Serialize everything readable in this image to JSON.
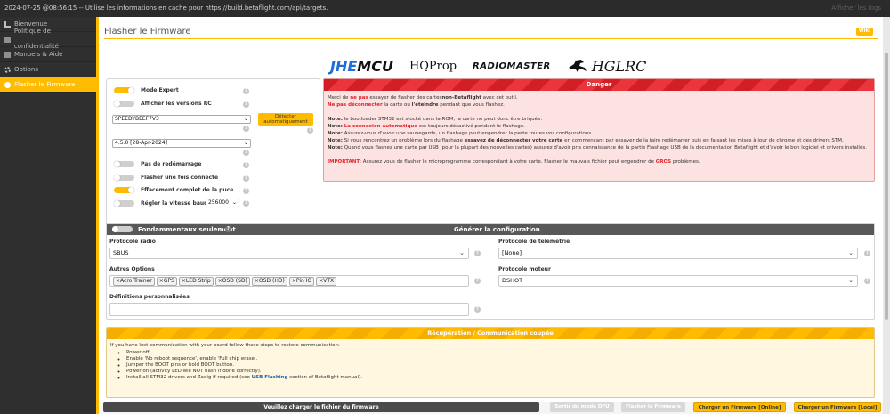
{
  "logbar": {
    "message": "2024-07-25 @08:56:15 -- Utilise les informations en cache pour https://build.betaflight.com/api/targets.",
    "show_log": "Afficher les logs"
  },
  "sidebar": {
    "items": [
      {
        "label": "Bienvenue",
        "icon": "home-icon"
      },
      {
        "label": "Politique de confidentialité",
        "icon": "document-icon"
      },
      {
        "label": "Manuels & Aide",
        "icon": "book-icon"
      },
      {
        "label": "Options",
        "icon": "gear-icon"
      },
      {
        "label": "Flasher le Firmware",
        "icon": "flash-icon",
        "active": true
      }
    ]
  },
  "header": {
    "title": "Flasher le Firmware",
    "wiki": "WIKI"
  },
  "logos": {
    "jhe": "JHE",
    "mcu": "MCU",
    "hqprop": "HQProp",
    "radiomaster": "RADIOMASTER",
    "hglrc": "HGLRC"
  },
  "options": {
    "expert_mode": "Mode Expert",
    "show_rc": "Afficher les versions RC",
    "target": "SPEEDYBEEF7V3",
    "detect": "Détecter automatiquement",
    "version": "4.5.0 [28-Apr-2024]",
    "no_reboot": "Pas de redémarrage",
    "flash_once": "Flasher une fois connecté",
    "full_erase": "Effacement complet de la puce",
    "baud_label": "Régler la vitesse baud",
    "baud": "256000"
  },
  "danger": {
    "title": "Danger",
    "l1a": "Merci de ",
    "l1b": "ne pas",
    "l1c": " essayer de flasher des cartes",
    "l1d": "non-Betaflight",
    "l1e": " avec cet outil.",
    "l2a": "Ne pas déconnecter",
    "l2b": " la carte ou ",
    "l2c": "l'éteindre",
    "l2d": " pendant que vous flashez.",
    "n1a": "Note:",
    "n1b": " le bootloader STM32 est stocké dans la ROM, la carte ne peut donc être briquée.",
    "n2a": "Note:",
    "n2b": "La connexion automatique",
    "n2c": " est toujours désactivé pendant le flashage.",
    "n3a": "Note:",
    "n3b": " Assurez-vous d'avoir une sauvegarde, un flashage peut engendrer la perte toutes vos configurations...",
    "n4a": "Note:",
    "n4b": " Si vous rencontrez un problème lors du flashage ",
    "n4c": "essayez de déconnecter votre carte",
    "n4d": " en commençant par essayer de la faire redémarrer puis en faisant les mises à jour de chrome et des drivers STM.",
    "n5a": "Note:",
    "n5b": " Quand vous flashez une carte par USB (pour la plupart des nouvelles cartes) assurez d'avoir pris connaissance de la partie Flashage USB de la documentation Betaflight et d'avoir le bon logiciel et drivers installés.",
    "impa": "IMPORTANT",
    "impb": ": Assurez vous de flasher le microprogramme correspondant à votre carte. Flasher le mauvais fichier peut engendrer de ",
    "impc": "GROS",
    "impd": " problèmes."
  },
  "build": {
    "core_only": "Fondammentaux seulement",
    "title": "Générer la configuration",
    "radio_label": "Protocole radio",
    "radio_value": "SBUS",
    "telemetry_label": "Protocole de télémétrie",
    "telemetry_value": "[None]",
    "other_label": "Autres Options",
    "other_chips": [
      "×Acro Trainer",
      "×GPS",
      "×LED Strip",
      "×OSD (SD)",
      "×OSD (HD)",
      "×Pin IO",
      "×VTX"
    ],
    "motor_label": "Protocole moteur",
    "motor_value": "DSHOT",
    "custom_label": "Définitions personnalisées"
  },
  "recovery": {
    "title": "Récupération / Communication coupée",
    "intro": "If you have lost communication with your board follow these steps to restore communication:",
    "steps": [
      "Power off",
      "Enable 'No reboot sequence', enable 'Full chip erase'.",
      "Jumper the BOOT pins or hold BOOT button.",
      "Power on (activity LED will NOT flash if done correctly).",
      "Install all STM32 drivers and Zadig if required (see "
    ],
    "link": "USB Flashing",
    "tail": " section of Betaflight manual)."
  },
  "bottom": {
    "status": "Veuillez charger le fichier du firmware",
    "exit_dfu": "Sortir du mode DFU",
    "flash": "Flasher le Firmware",
    "load_online": "Charger un Firmware [Online]",
    "load_local": "Charger un Firmware [Local]"
  }
}
